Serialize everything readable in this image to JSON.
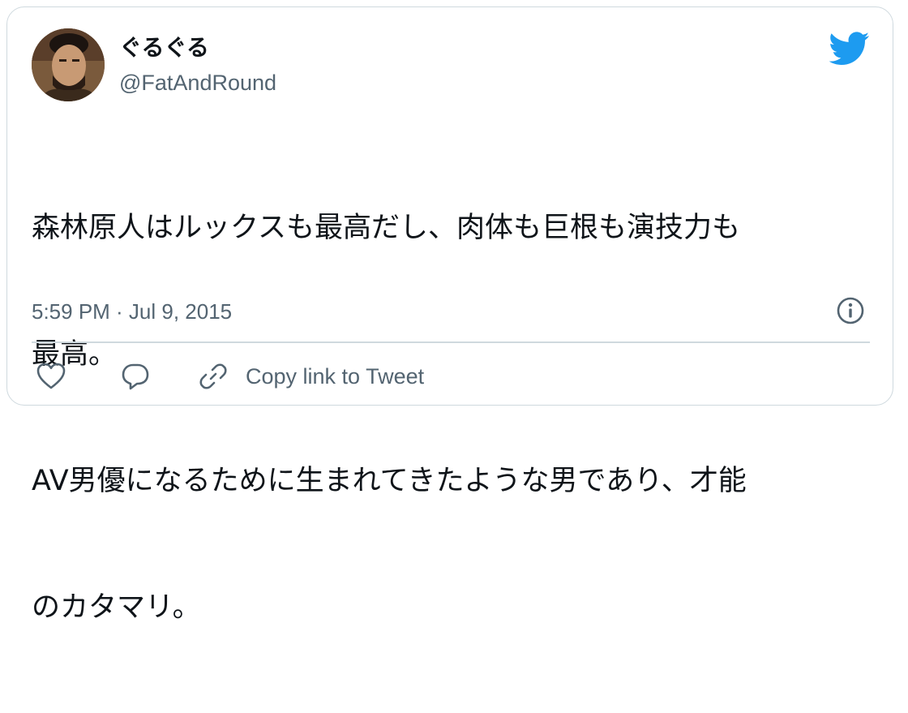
{
  "tweet": {
    "display_name": "ぐるぐる",
    "handle": "@FatAndRound",
    "text_lines": [
      "森林原人はルックスも最高だし、肉体も巨根も演技力も",
      "最高。",
      "AV男優になるために生まれてきたような男であり、才能",
      "のカタマリ。"
    ],
    "timestamp": "5:59 PM · Jul 9, 2015"
  },
  "actions": {
    "copy_link_label": "Copy link to Tweet"
  },
  "icons": {
    "brand": "twitter-bird-icon",
    "info": "info-icon",
    "like": "heart-icon",
    "reply": "reply-bubble-icon",
    "copy": "link-icon"
  },
  "colors": {
    "brand_blue": "#1d9bf0",
    "text_primary": "#0f1419",
    "text_secondary": "#536471",
    "border": "#cfd9de"
  }
}
